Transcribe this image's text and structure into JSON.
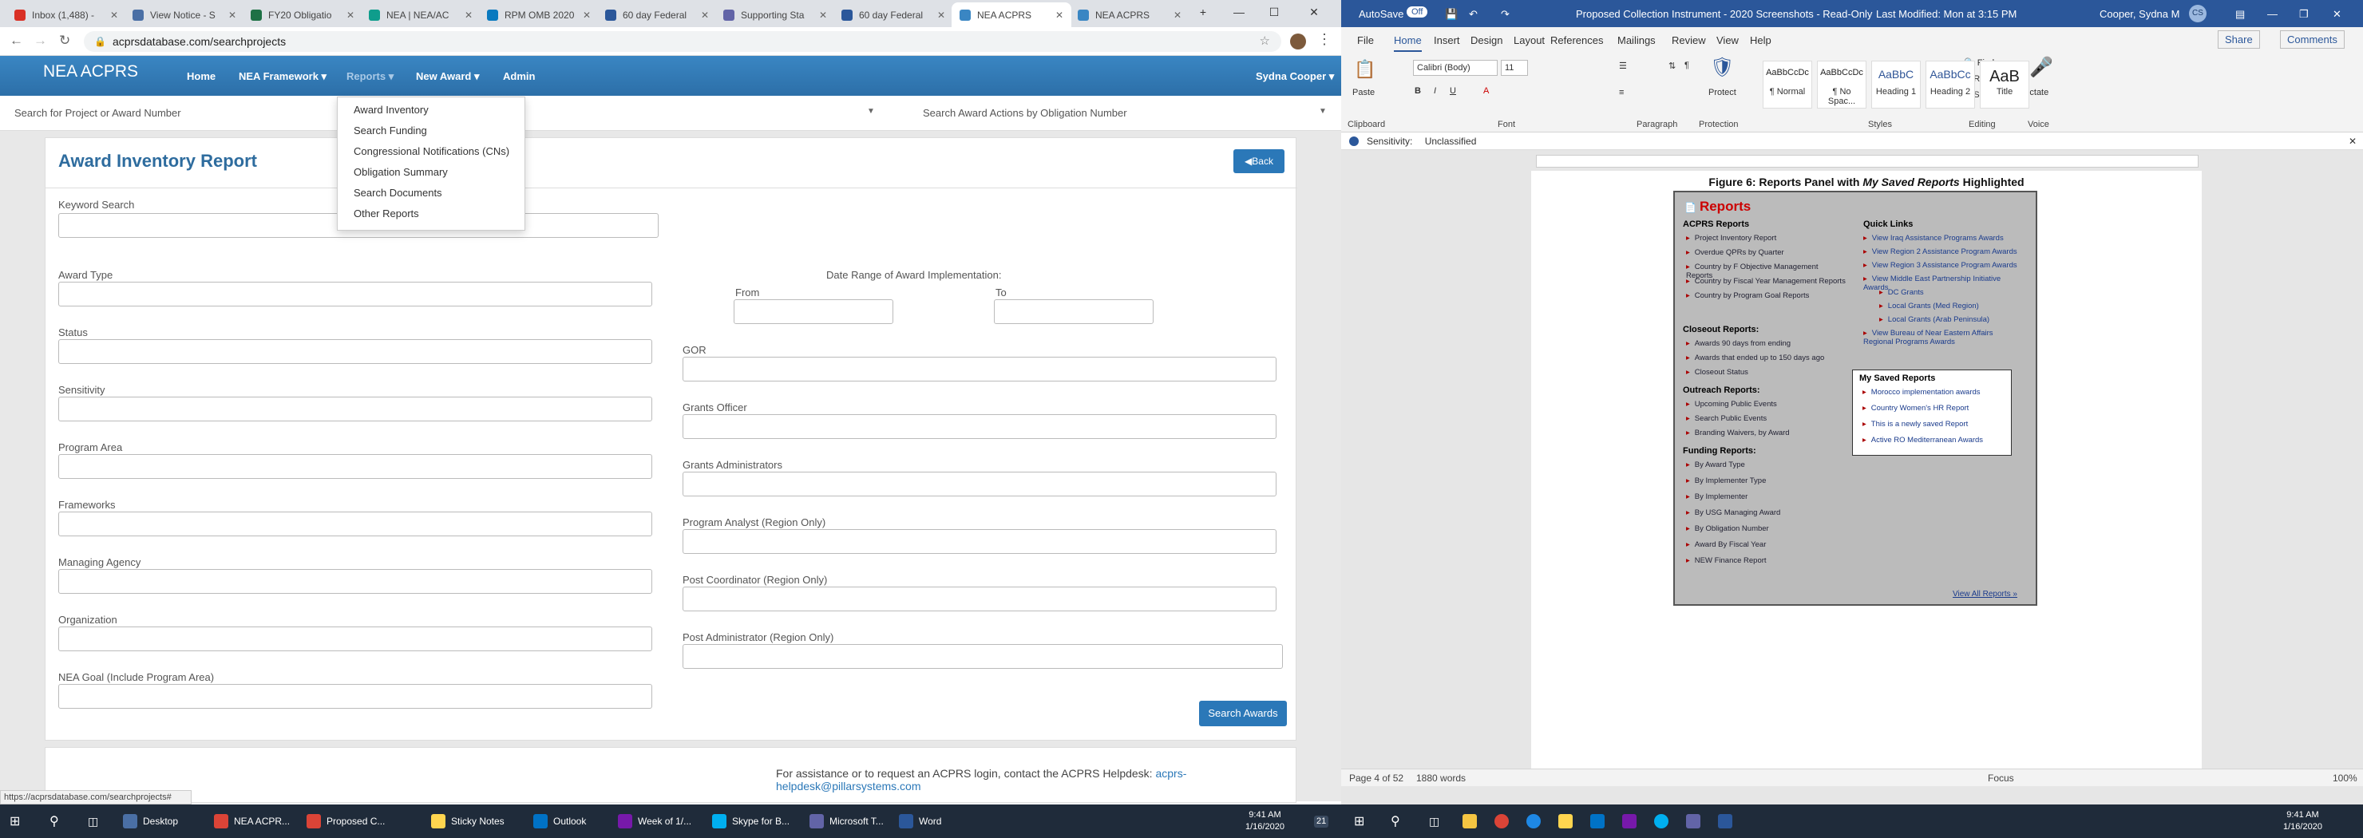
{
  "browser": {
    "tabs": [
      {
        "label": "Inbox (1,488) -",
        "color": "#d93025",
        "letter": "M"
      },
      {
        "label": "View Notice - S",
        "color": "#4a6fa5",
        "letter": ""
      },
      {
        "label": "FY20 Obligatio",
        "color": "#1e7145",
        "letter": ""
      },
      {
        "label": "NEA | NEA/AC",
        "color": "#0f9d8c",
        "letter": ""
      },
      {
        "label": "RPM OMB 2020",
        "color": "#0a7abf",
        "letter": ""
      },
      {
        "label": "60 day Federal",
        "color": "#2b579a",
        "letter": "W"
      },
      {
        "label": "Supporting Sta",
        "color": "#6264a7",
        "letter": ""
      },
      {
        "label": "60 day Federal",
        "color": "#2b579a",
        "letter": "W"
      },
      {
        "label": "NEA ACPRS",
        "color": "#3a86c3",
        "letter": ""
      },
      {
        "label": "NEA ACPRS",
        "color": "#3a86c3",
        "letter": ""
      }
    ],
    "new_tab": "+",
    "url": "acprsdatabase.com/searchprojects",
    "status_url": "https://acprsdatabase.com/searchprojects#"
  },
  "app": {
    "brand": "NEA ACPRS",
    "nav": {
      "home": "Home",
      "framework": "NEA Framework ▾",
      "reports": "Reports ▾",
      "new_award": "New Award ▾",
      "admin": "Admin",
      "user": "Sydna Cooper ▾"
    },
    "search_project_placeholder": "Search for Project or Award Number",
    "search_obligation_placeholder": "Search Award Actions by Obligation Number",
    "reports_menu": [
      "Award Inventory",
      "Search Funding",
      "Congressional Notifications (CNs)",
      "Obligation Summary",
      "Search Documents",
      "Other Reports"
    ],
    "page_title": "Award Inventory Report",
    "back_label": "Back",
    "fields": {
      "keyword": "Keyword Search",
      "award_type": "Award Type",
      "status": "Status",
      "sensitivity": "Sensitivity",
      "program_area": "Program Area",
      "frameworks": "Frameworks",
      "managing_agency": "Managing Agency",
      "organization": "Organization",
      "nea_goal": "NEA Goal (Include Program Area)",
      "date_range": "Date Range of Award Implementation:",
      "from": "From",
      "to": "To",
      "gor": "GOR",
      "grants_officer": "Grants Officer",
      "grants_admins": "Grants Administrators",
      "program_analyst": "Program Analyst (Region Only)",
      "post_coordinator": "Post Coordinator (Region Only)",
      "post_admin": "Post Administrator (Region Only)"
    },
    "search_awards": "Search Awards",
    "help_text": "For assistance or to request an ACPRS login, contact the ACPRS Helpdesk: ",
    "help_email": "acprs-helpdesk@pillarsystems.com"
  },
  "word": {
    "autosave": "AutoSave",
    "autosave_state": "Off",
    "doc_title": "Proposed Collection Instrument - 2020 Screenshots - Read-Only",
    "last_modified": "Last Modified: Mon at 3:15 PM",
    "user": "Cooper, Sydna M",
    "user_initials": "CS",
    "share": "Share",
    "comments": "Comments",
    "menu": [
      "File",
      "Home",
      "Insert",
      "Design",
      "Layout",
      "References",
      "Mailings",
      "Review",
      "View",
      "Help"
    ],
    "ribbon": {
      "paste": "Paste",
      "clipboard": "Clipboard",
      "font_name": "Calibri (Body)",
      "font_size": "11",
      "font_group": "Font",
      "paragraph_group": "Paragraph",
      "protect": "Protect",
      "protection_group": "Protection",
      "styles": [
        {
          "preview": "AaBbCcDc",
          "name": "¶ Normal"
        },
        {
          "preview": "AaBbCcDc",
          "name": "¶ No Spac..."
        },
        {
          "preview": "AaBbC",
          "name": "Heading 1"
        },
        {
          "preview": "AaBbCc",
          "name": "Heading 2"
        },
        {
          "preview": "AaB",
          "name": "Title"
        }
      ],
      "styles_group": "Styles",
      "find": "Find",
      "replace": "Replace",
      "select": "Select",
      "editing_group": "Editing",
      "dictate": "Dictate",
      "voice_group": "Voice"
    },
    "sensitivity_label": "Sensitivity:",
    "sensitivity_value": "Unclassified",
    "caption_pre": "Figure 6: Reports Panel with ",
    "caption_em": "My Saved Reports",
    "caption_post": " Highlighted",
    "figure": {
      "heading": "Reports",
      "acprs_heading": "ACPRS Reports",
      "acprs": [
        "Project Inventory Report",
        "Overdue QPRs by Quarter",
        "Country by F Objective Management Reports",
        "Country by Fiscal Year Management Reports",
        "Country by Program Goal Reports"
      ],
      "closeout_heading": "Closeout Reports:",
      "closeout": [
        "Awards 90 days from ending",
        "Awards that ended up to 150 days ago",
        "Closeout Status"
      ],
      "outreach_heading": "Outreach Reports:",
      "outreach": [
        "Upcoming Public Events",
        "Search Public Events",
        "Branding Waivers, by Award"
      ],
      "funding_heading": "Funding Reports:",
      "funding": [
        "By Award Type",
        "By Implementer Type",
        "By Implementer",
        "By USG Managing Award",
        "By Obligation Number",
        "Award By Fiscal Year",
        "NEW Finance Report"
      ],
      "quick_heading": "Quick Links",
      "quick": [
        "View Iraq Assistance Programs Awards",
        "View Region 2 Assistance Program Awards",
        "View Region 3 Assistance Program Awards",
        "View Middle East Partnership Initiative Awards",
        "DC Grants",
        "Local Grants (Med Region)",
        "Local Grants (Arab Peninsula)",
        "View Bureau of Near Eastern Affairs Regional Programs Awards"
      ],
      "saved_heading": "My Saved Reports",
      "saved": [
        "Morocco implementation awards",
        "Country Women's HR Report",
        "This is a newly saved Report",
        "Active RO Mediterranean Awards"
      ],
      "view_all": "View All Reports »"
    },
    "status": {
      "page": "Page 4 of 52",
      "words": "1880 words",
      "focus": "Focus",
      "zoom": "100%"
    }
  },
  "taskbar_left": {
    "items": [
      "Desktop",
      "NEA ACPR...",
      "Proposed C...",
      "Sticky Notes",
      "Outlook",
      "Week of 1/...",
      "Skype for B...",
      "Microsoft T...",
      "Word"
    ],
    "time": "9:41 AM",
    "date": "1/16/2020",
    "badge": "21"
  },
  "taskbar_right": {
    "time": "9:41 AM",
    "date": "1/16/2020"
  }
}
